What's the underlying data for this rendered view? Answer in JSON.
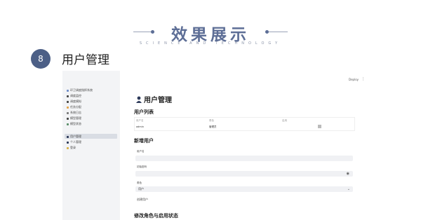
{
  "slide": {
    "title": "效果展示",
    "subtitle": "SCIENCE AND TECHNOLOGY",
    "section_number": "8",
    "section_title": "用户管理"
  },
  "app": {
    "deploy_label": "Deploy",
    "menu_icon": "more-vertical-icon",
    "sidebar": {
      "items": [
        {
          "label": "环卫调度指挥系统",
          "icon": "home-icon",
          "icon_color": "#6b8ac7"
        },
        {
          "label": "调度监控",
          "icon": "monitor-icon",
          "icon_color": "#444444"
        },
        {
          "label": "调度模拟",
          "icon": "print-icon",
          "icon_color": "#444444"
        },
        {
          "label": "任务分配",
          "icon": "edit-icon",
          "icon_color": "#e3a34a"
        },
        {
          "label": "系统日志",
          "icon": "log-icon",
          "icon_color": "#7a7a7a"
        },
        {
          "label": "模型管理",
          "icon": "model-icon",
          "icon_color": "#444444"
        },
        {
          "label": "模型状态",
          "icon": "status-icon",
          "icon_color": "#5b8f6a"
        },
        {
          "label": "用户管理",
          "icon": "user-icon",
          "icon_color": "#2d3a5a",
          "active": true
        },
        {
          "label": "个人管理",
          "icon": "person-icon",
          "icon_color": "#2d3a5a"
        },
        {
          "label": "登录",
          "icon": "login-icon",
          "icon_color": "#d9b24a"
        }
      ]
    },
    "page_title": "用户管理",
    "user_list": {
      "heading": "用户列表",
      "columns": [
        "用户名",
        "角色",
        "启用"
      ],
      "rows": [
        {
          "username": "admin",
          "role": "管理员"
        }
      ]
    },
    "add_user": {
      "heading": "新增用户",
      "username_label": "用户名",
      "password_label": "初始密码",
      "role_label": "角色",
      "role_value": "用户",
      "create_button": "创建用户"
    },
    "edit_role_heading": "修改角色与启用状态"
  }
}
